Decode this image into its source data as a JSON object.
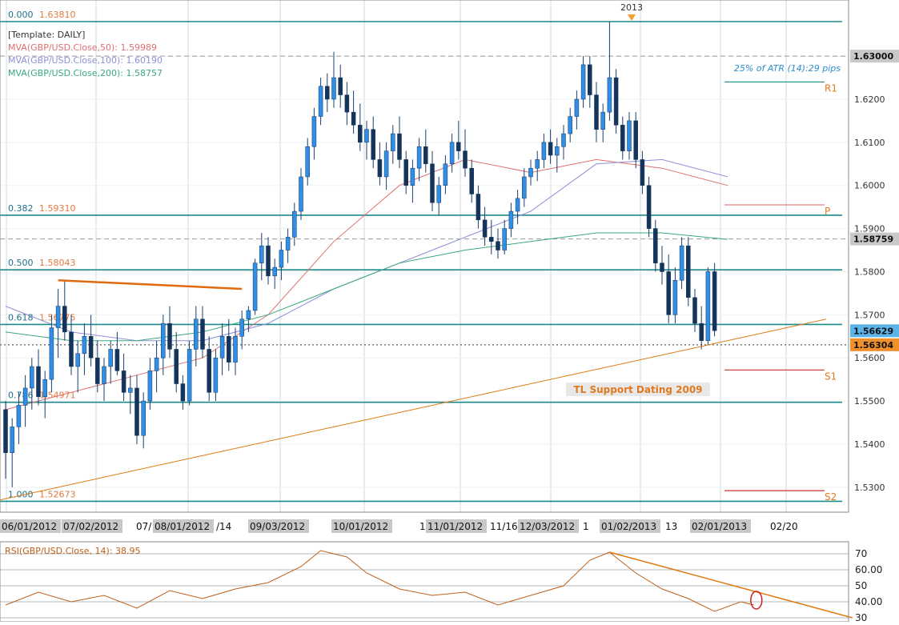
{
  "chart_data": [
    {
      "type": "candlestick",
      "symbol": "GBP/USD",
      "template_label": "[Template: DAILY]",
      "y_range": [
        1.527,
        1.638
      ],
      "y_ticks": [
        "1.5300",
        "1.5400",
        "1.5500",
        "1.5600",
        "1.5700",
        "1.5800",
        "1.5900",
        "1.6000",
        "1.6100",
        "1.6200",
        "1.6300"
      ],
      "price_tags": [
        {
          "label": "1.63000",
          "value": 1.63,
          "style": "gray"
        },
        {
          "label": "1.58759",
          "value": 1.58759,
          "style": "gray"
        },
        {
          "label": "1.56629",
          "value": 1.56629,
          "style": "blue"
        },
        {
          "label": "1.56304",
          "value": 1.56304,
          "style": "orange"
        }
      ],
      "x_labels": [
        "06/01/2012",
        "07/02/2012",
        "07/",
        "08/01/2012",
        "/14",
        "09/03/2012",
        "10/01/2012",
        "1",
        "11/01/2012",
        "11/16",
        "12/03/2012",
        "1",
        "01/02/2013",
        "13",
        "02/01/2013",
        "02/20"
      ],
      "top_marker": "2013",
      "moving_averages": [
        {
          "label": "MVA(GBP/USD.Close,50): 1.59989",
          "color": "#e06f6f"
        },
        {
          "label": "MVA(GBP/USD.Close,100): 1.60190",
          "color": "#8f8fd8"
        },
        {
          "label": "MVA(GBP/USD.Close,200): 1.58757",
          "color": "#3aa87e"
        }
      ],
      "fib_levels": [
        {
          "ratio": "0.000",
          "value": 1.638,
          "value_label": "1.63810"
        },
        {
          "ratio": "0.382",
          "value": 1.5931,
          "value_label": "1.59310"
        },
        {
          "ratio": "0.500",
          "value": 1.58043,
          "value_label": "1.58043"
        },
        {
          "ratio": "0.618",
          "value": 1.56775,
          "value_label": "1.56775"
        },
        {
          "ratio": "0.786",
          "value": 1.54971,
          "value_label": "1.54971"
        },
        {
          "ratio": "1.000",
          "value": 1.52673,
          "value_label": "1.52673"
        }
      ],
      "pivot_levels": [
        {
          "label": "R1",
          "value": 1.624
        },
        {
          "label": "P",
          "value": 1.5955
        },
        {
          "label": "S1",
          "value": 1.5572
        },
        {
          "label": "S2",
          "value": 1.5292
        }
      ],
      "annotations": {
        "atr_note": "25% of ATR (14):29 pips",
        "trendline_label": "TL Support Dating 2009"
      },
      "candles": [
        [
          1.548,
          1.55,
          1.532,
          1.538
        ],
        [
          1.538,
          1.546,
          1.53,
          1.544
        ],
        [
          1.544,
          1.552,
          1.54,
          1.549
        ],
        [
          1.549,
          1.556,
          1.544,
          1.553
        ],
        [
          1.553,
          1.56,
          1.548,
          1.558
        ],
        [
          1.558,
          1.562,
          1.549,
          1.551
        ],
        [
          1.551,
          1.557,
          1.546,
          1.555
        ],
        [
          1.555,
          1.57,
          1.552,
          1.567
        ],
        [
          1.567,
          1.576,
          1.56,
          1.572
        ],
        [
          1.572,
          1.578,
          1.564,
          1.566
        ],
        [
          1.566,
          1.57,
          1.556,
          1.558
        ],
        [
          1.558,
          1.564,
          1.552,
          1.561
        ],
        [
          1.561,
          1.568,
          1.556,
          1.565
        ],
        [
          1.565,
          1.57,
          1.558,
          1.56
        ],
        [
          1.56,
          1.564,
          1.552,
          1.554
        ],
        [
          1.554,
          1.56,
          1.55,
          1.558
        ],
        [
          1.558,
          1.564,
          1.554,
          1.562
        ],
        [
          1.562,
          1.566,
          1.556,
          1.557
        ],
        [
          1.557,
          1.561,
          1.55,
          1.552
        ],
        [
          1.552,
          1.556,
          1.547,
          1.553
        ],
        [
          1.553,
          1.556,
          1.54,
          1.542
        ],
        [
          1.542,
          1.552,
          1.539,
          1.55
        ],
        [
          1.55,
          1.56,
          1.548,
          1.557
        ],
        [
          1.557,
          1.564,
          1.552,
          1.56
        ],
        [
          1.56,
          1.57,
          1.556,
          1.568
        ],
        [
          1.568,
          1.572,
          1.56,
          1.562
        ],
        [
          1.562,
          1.566,
          1.552,
          1.554
        ],
        [
          1.554,
          1.556,
          1.548,
          1.55
        ],
        [
          1.55,
          1.564,
          1.549,
          1.562
        ],
        [
          1.562,
          1.572,
          1.558,
          1.569
        ],
        [
          1.569,
          1.572,
          1.56,
          1.562
        ],
        [
          1.562,
          1.565,
          1.55,
          1.552
        ],
        [
          1.552,
          1.562,
          1.55,
          1.56
        ],
        [
          1.56,
          1.568,
          1.556,
          1.565
        ],
        [
          1.565,
          1.569,
          1.557,
          1.559
        ],
        [
          1.559,
          1.567,
          1.556,
          1.565
        ],
        [
          1.565,
          1.571,
          1.562,
          1.569
        ],
        [
          1.569,
          1.572,
          1.566,
          1.571
        ],
        [
          1.571,
          1.583,
          1.57,
          1.582
        ],
        [
          1.582,
          1.589,
          1.578,
          1.586
        ],
        [
          1.586,
          1.588,
          1.577,
          1.579
        ],
        [
          1.579,
          1.583,
          1.576,
          1.581
        ],
        [
          1.581,
          1.587,
          1.578,
          1.585
        ],
        [
          1.585,
          1.59,
          1.582,
          1.588
        ],
        [
          1.588,
          1.596,
          1.586,
          1.594
        ],
        [
          1.594,
          1.604,
          1.592,
          1.602
        ],
        [
          1.602,
          1.611,
          1.6,
          1.609
        ],
        [
          1.609,
          1.618,
          1.606,
          1.616
        ],
        [
          1.616,
          1.625,
          1.614,
          1.623
        ],
        [
          1.623,
          1.626,
          1.617,
          1.62
        ],
        [
          1.62,
          1.631,
          1.618,
          1.625
        ],
        [
          1.625,
          1.628,
          1.618,
          1.621
        ],
        [
          1.621,
          1.624,
          1.614,
          1.617
        ],
        [
          1.617,
          1.622,
          1.612,
          1.614
        ],
        [
          1.614,
          1.619,
          1.608,
          1.61
        ],
        [
          1.61,
          1.615,
          1.606,
          1.613
        ],
        [
          1.613,
          1.616,
          1.604,
          1.606
        ],
        [
          1.606,
          1.61,
          1.6,
          1.602
        ],
        [
          1.602,
          1.61,
          1.599,
          1.608
        ],
        [
          1.608,
          1.614,
          1.605,
          1.612
        ],
        [
          1.612,
          1.616,
          1.604,
          1.606
        ],
        [
          1.606,
          1.608,
          1.598,
          1.6
        ],
        [
          1.6,
          1.606,
          1.596,
          1.604
        ],
        [
          1.604,
          1.611,
          1.601,
          1.609
        ],
        [
          1.609,
          1.613,
          1.603,
          1.605
        ],
        [
          1.605,
          1.608,
          1.594,
          1.596
        ],
        [
          1.596,
          1.602,
          1.593,
          1.6
        ],
        [
          1.6,
          1.607,
          1.598,
          1.605
        ],
        [
          1.605,
          1.612,
          1.603,
          1.61
        ],
        [
          1.61,
          1.615,
          1.606,
          1.608
        ],
        [
          1.608,
          1.613,
          1.602,
          1.604
        ],
        [
          1.604,
          1.606,
          1.596,
          1.598
        ],
        [
          1.598,
          1.6,
          1.59,
          1.592
        ],
        [
          1.592,
          1.595,
          1.586,
          1.588
        ],
        [
          1.588,
          1.592,
          1.584,
          1.587
        ],
        [
          1.587,
          1.59,
          1.583,
          1.585
        ],
        [
          1.585,
          1.592,
          1.584,
          1.59
        ],
        [
          1.59,
          1.596,
          1.588,
          1.594
        ],
        [
          1.594,
          1.599,
          1.591,
          1.597
        ],
        [
          1.597,
          1.604,
          1.595,
          1.602
        ],
        [
          1.602,
          1.606,
          1.6,
          1.604
        ],
        [
          1.604,
          1.608,
          1.601,
          1.606
        ],
        [
          1.606,
          1.612,
          1.604,
          1.61
        ],
        [
          1.61,
          1.613,
          1.605,
          1.607
        ],
        [
          1.607,
          1.611,
          1.603,
          1.609
        ],
        [
          1.609,
          1.614,
          1.606,
          1.612
        ],
        [
          1.612,
          1.618,
          1.61,
          1.616
        ],
        [
          1.616,
          1.622,
          1.613,
          1.62
        ],
        [
          1.62,
          1.63,
          1.618,
          1.628
        ],
        [
          1.628,
          1.63,
          1.618,
          1.621
        ],
        [
          1.621,
          1.624,
          1.61,
          1.613
        ],
        [
          1.613,
          1.619,
          1.61,
          1.617
        ],
        [
          1.617,
          1.638,
          1.615,
          1.625
        ],
        [
          1.625,
          1.627,
          1.612,
          1.614
        ],
        [
          1.614,
          1.616,
          1.606,
          1.608
        ],
        [
          1.608,
          1.617,
          1.606,
          1.615
        ],
        [
          1.615,
          1.617,
          1.604,
          1.606
        ],
        [
          1.606,
          1.608,
          1.598,
          1.6
        ],
        [
          1.6,
          1.602,
          1.588,
          1.59
        ],
        [
          1.59,
          1.592,
          1.58,
          1.582
        ],
        [
          1.582,
          1.586,
          1.577,
          1.58
        ],
        [
          1.58,
          1.584,
          1.568,
          1.57
        ],
        [
          1.57,
          1.581,
          1.568,
          1.578
        ],
        [
          1.578,
          1.588,
          1.576,
          1.586
        ],
        [
          1.586,
          1.588,
          1.572,
          1.574
        ],
        [
          1.574,
          1.576,
          1.566,
          1.568
        ],
        [
          1.568,
          1.572,
          1.562,
          1.564
        ],
        [
          1.564,
          1.581,
          1.563,
          1.58
        ],
        [
          1.58,
          1.582,
          1.565,
          1.5663
        ]
      ],
      "ma_series": {
        "ma50": [
          [
            0,
            1.548
          ],
          [
            10,
            1.552
          ],
          [
            20,
            1.556
          ],
          [
            30,
            1.56
          ],
          [
            40,
            1.57
          ],
          [
            50,
            1.587
          ],
          [
            60,
            1.6
          ],
          [
            70,
            1.606
          ],
          [
            80,
            1.603
          ],
          [
            90,
            1.606
          ],
          [
            100,
            1.604
          ],
          [
            110,
            1.6
          ]
        ],
        "ma100": [
          [
            0,
            1.572
          ],
          [
            10,
            1.566
          ],
          [
            20,
            1.564
          ],
          [
            30,
            1.564
          ],
          [
            40,
            1.568
          ],
          [
            50,
            1.576
          ],
          [
            60,
            1.582
          ],
          [
            70,
            1.588
          ],
          [
            80,
            1.594
          ],
          [
            90,
            1.605
          ],
          [
            100,
            1.606
          ],
          [
            110,
            1.602
          ]
        ],
        "ma200": [
          [
            0,
            1.566
          ],
          [
            10,
            1.564
          ],
          [
            20,
            1.564
          ],
          [
            30,
            1.566
          ],
          [
            40,
            1.57
          ],
          [
            50,
            1.576
          ],
          [
            60,
            1.582
          ],
          [
            70,
            1.585
          ],
          [
            80,
            1.587
          ],
          [
            90,
            1.589
          ],
          [
            100,
            1.589
          ],
          [
            110,
            1.5875
          ]
        ]
      },
      "resistance_line": {
        "from": [
          8,
          1.578
        ],
        "to": [
          36,
          1.576
        ]
      },
      "support_trendline": {
        "from": [
          -1,
          1.527
        ],
        "to": [
          125,
          1.569
        ]
      }
    },
    {
      "type": "line",
      "indicator_label": "RSI(GBP/USD.Close, 14): 38.95",
      "y_range": [
        29,
        76
      ],
      "y_ticks": [
        "70",
        "60.00",
        "50",
        "40.00",
        "30"
      ],
      "rsi": [
        [
          0,
          38
        ],
        [
          5,
          46
        ],
        [
          10,
          40
        ],
        [
          15,
          44
        ],
        [
          20,
          36
        ],
        [
          25,
          47
        ],
        [
          30,
          42
        ],
        [
          35,
          48
        ],
        [
          40,
          52
        ],
        [
          45,
          62
        ],
        [
          48,
          72
        ],
        [
          52,
          68
        ],
        [
          55,
          58
        ],
        [
          60,
          48
        ],
        [
          65,
          44
        ],
        [
          70,
          46
        ],
        [
          75,
          38
        ],
        [
          80,
          44
        ],
        [
          85,
          50
        ],
        [
          89,
          66
        ],
        [
          92,
          71
        ],
        [
          96,
          58
        ],
        [
          100,
          48
        ],
        [
          104,
          42
        ],
        [
          108,
          34
        ],
        [
          112,
          40
        ],
        [
          114,
          38
        ]
      ],
      "rsi_trendline": {
        "from": [
          92,
          71
        ],
        "to": [
          129,
          30
        ]
      },
      "circle_at": [
        114,
        41
      ]
    }
  ]
}
